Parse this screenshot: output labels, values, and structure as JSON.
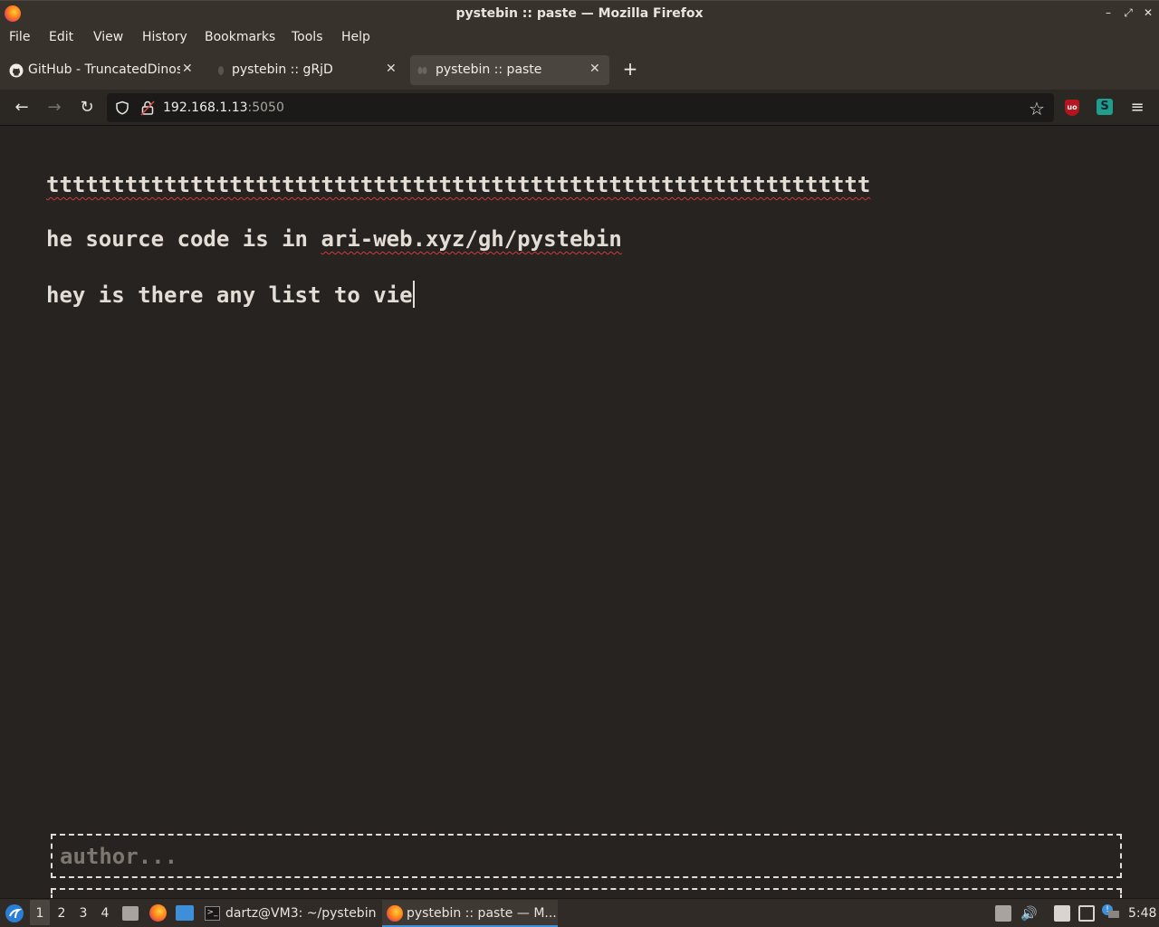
{
  "window": {
    "title": "pystebin :: paste — Mozilla Firefox"
  },
  "menu": [
    "File",
    "Edit",
    "View",
    "History",
    "Bookmarks",
    "Tools",
    "Help"
  ],
  "tabs": [
    {
      "label": "GitHub - TruncatedDinos",
      "icon": "github-icon"
    },
    {
      "label": "pystebin :: gRjD",
      "icon": "page-icon"
    },
    {
      "label": "pystebin :: paste",
      "icon": "page-icon",
      "active": true
    }
  ],
  "url": {
    "host": "192.168.1.13",
    "port": ":5050"
  },
  "paste": {
    "lines": [
      "ttttttttttttttttttttttttttttttttttttttttttttttttttttttttttttttt",
      "he source code is in ",
      "ari-web.xyz/gh/pystebin",
      "hey is there any list to vie"
    ],
    "author_placeholder": "author..."
  },
  "taskbar": {
    "workspaces": [
      "1",
      "2",
      "3",
      "4"
    ],
    "tasks": [
      {
        "label": "dartz@VM3: ~/pystebin",
        "icon": "terminal-icon"
      },
      {
        "label": "pystebin :: paste — M...",
        "icon": "firefox-icon",
        "active": true
      }
    ],
    "clock": "5:48"
  },
  "colors": {
    "page_bg": "#272320",
    "text": "#e3ddd5",
    "accent": "#3d8fd9",
    "spell_error": "#d13a3a"
  }
}
